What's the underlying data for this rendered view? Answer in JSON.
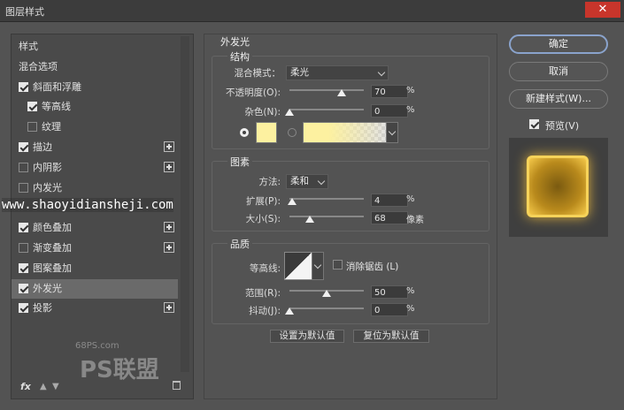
{
  "window": {
    "title": "图层样式",
    "close_label": "✕"
  },
  "left_panel": {
    "items": [
      {
        "label": "样式",
        "checkbox": null,
        "plus": false,
        "indent": 0
      },
      {
        "label": "混合选项",
        "checkbox": null,
        "plus": false,
        "indent": 0
      },
      {
        "label": "斜面和浮雕",
        "checkbox": true,
        "plus": false,
        "indent": 0
      },
      {
        "label": "等高线",
        "checkbox": true,
        "plus": false,
        "indent": 1
      },
      {
        "label": "纹理",
        "checkbox": false,
        "plus": false,
        "indent": 1
      },
      {
        "label": "描边",
        "checkbox": true,
        "plus": true,
        "indent": 0
      },
      {
        "label": "内阴影",
        "checkbox": false,
        "plus": true,
        "indent": 0
      },
      {
        "label": "内发光",
        "checkbox": false,
        "plus": false,
        "indent": 0
      },
      {
        "label": "",
        "checkbox": null,
        "plus": false,
        "indent": 0
      },
      {
        "label": "颜色叠加",
        "checkbox": true,
        "plus": true,
        "indent": 0
      },
      {
        "label": "渐变叠加",
        "checkbox": false,
        "plus": true,
        "indent": 0
      },
      {
        "label": "图案叠加",
        "checkbox": true,
        "plus": false,
        "indent": 0
      },
      {
        "label": "外发光",
        "checkbox": true,
        "plus": false,
        "indent": 0,
        "selected": true
      },
      {
        "label": "投影",
        "checkbox": true,
        "plus": true,
        "indent": 0
      }
    ],
    "fx_label": "fx"
  },
  "outer_glow": {
    "title": "外发光",
    "structure": {
      "title": "结构",
      "blend_mode_label": "混合模式：",
      "blend_mode_value": "柔光",
      "opacity_label": "不透明度(O):",
      "opacity_value": "70",
      "opacity_unit": "%",
      "opacity": 70,
      "noise_label": "杂色(N):",
      "noise_value": "0",
      "noise_unit": "%",
      "noise": 0,
      "glow_color": "#fdf1a0"
    },
    "elements": {
      "title": "图素",
      "method_label": "方法:",
      "method_value": "柔和",
      "spread_label": "扩展(P):",
      "spread_value": "4",
      "spread_unit": "%",
      "spread": 4,
      "size_label": "大小(S):",
      "size_value": "68",
      "size_unit": "像素",
      "size": 68
    },
    "quality": {
      "title": "品质",
      "contour_label": "等高线:",
      "antialias_label": "消除锯齿 (L)",
      "range_label": "范围(R):",
      "range_value": "50",
      "range_unit": "%",
      "range": 50,
      "jitter_label": "抖动(J):",
      "jitter_value": "0",
      "jitter_unit": "%",
      "jitter": 0
    },
    "set_default_label": "设置为默认值",
    "reset_default_label": "复位为默认值"
  },
  "right": {
    "ok_label": "确定",
    "cancel_label": "取消",
    "new_style_label": "新建样式(W)...",
    "preview_label": "预览(V)"
  },
  "watermarks": {
    "url": "www.shaoyidiansheji.com",
    "site": "68PS.com",
    "brand": "PS联盟"
  }
}
